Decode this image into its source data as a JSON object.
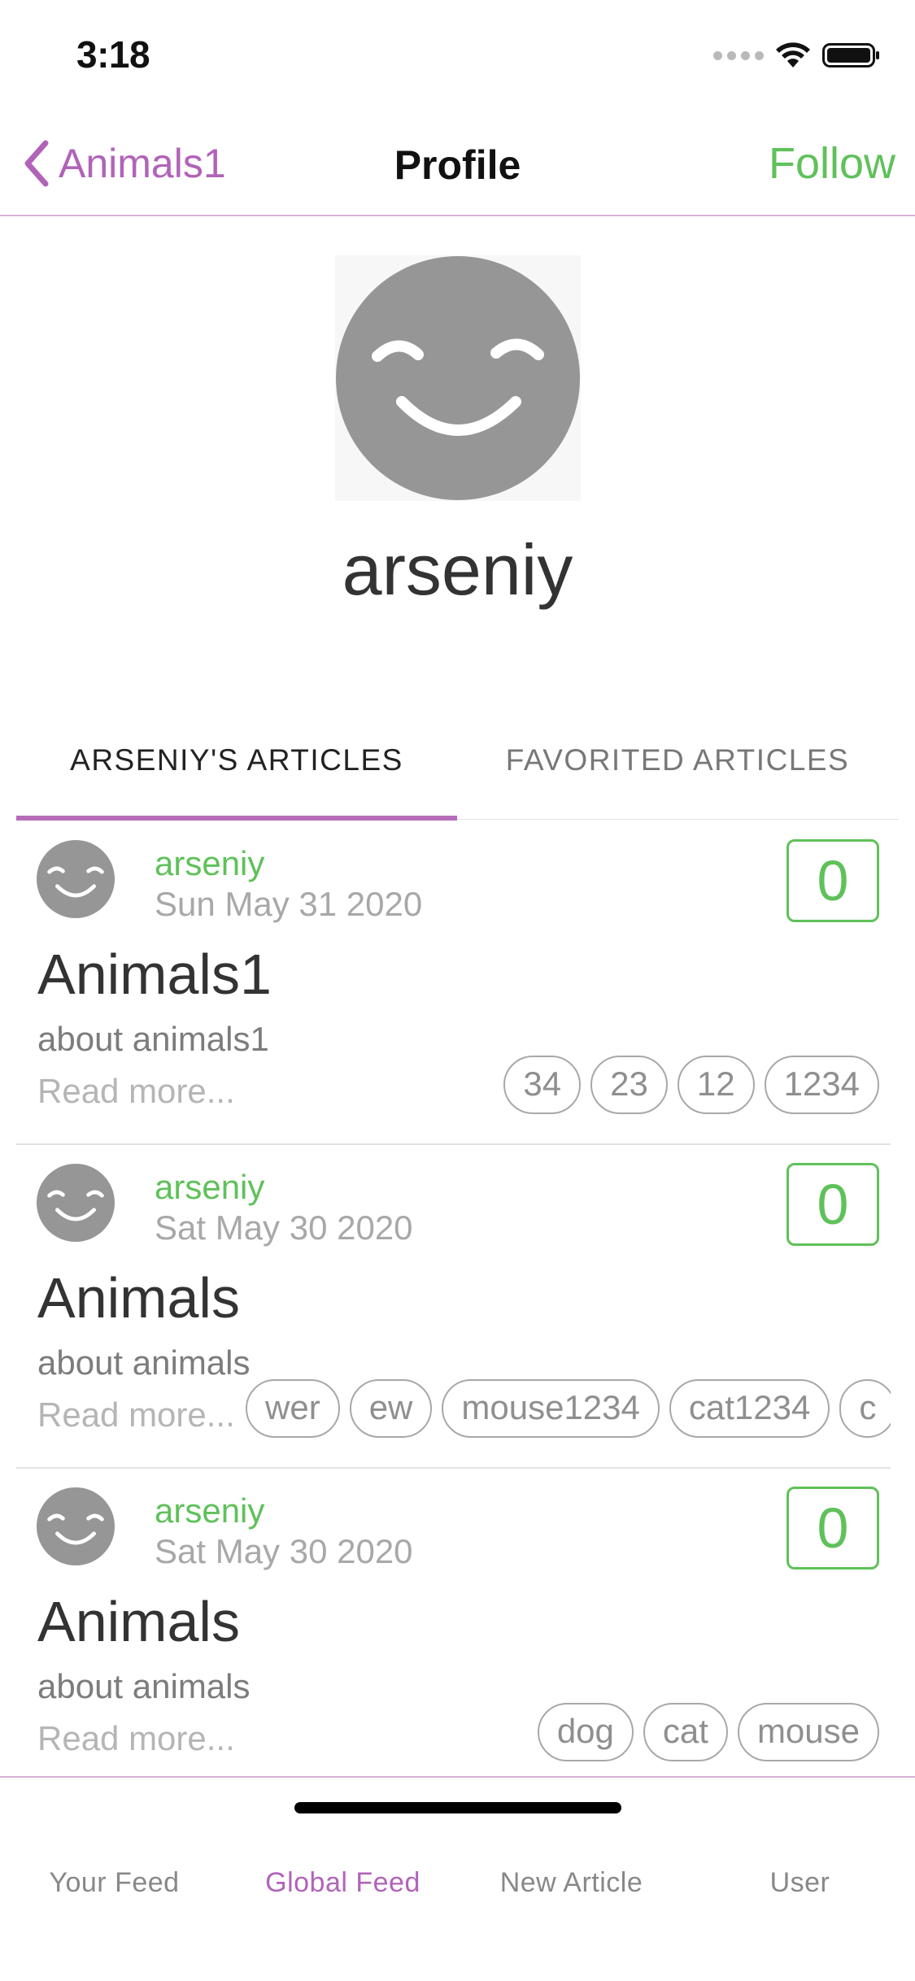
{
  "status_bar": {
    "time": "3:18"
  },
  "nav": {
    "back_label": "Animals1",
    "title": "Profile",
    "follow_label": "Follow"
  },
  "profile": {
    "username": "arseniy",
    "avatar_icon": "smiley-face-icon"
  },
  "tabs": [
    {
      "label": "ARSENIY'S ARTICLES",
      "active": true
    },
    {
      "label": "FAVORITED ARTICLES",
      "active": false
    }
  ],
  "articles": [
    {
      "author": "arseniy",
      "date": "Sun May 31 2020",
      "favorites": "0",
      "title": "Animals1",
      "description": "about animals1",
      "read_more": "Read more...",
      "tags": [
        "34",
        "23",
        "12",
        "1234"
      ]
    },
    {
      "author": "arseniy",
      "date": "Sat May 30 2020",
      "favorites": "0",
      "title": "Animals",
      "description": "about animals",
      "read_more": "Read more...",
      "tags": [
        "wer",
        "ew",
        "mouse1234",
        "cat1234",
        "c"
      ]
    },
    {
      "author": "arseniy",
      "date": "Sat May 30 2020",
      "favorites": "0",
      "title": "Animals",
      "description": "about animals",
      "read_more": "Read more...",
      "tags": [
        "dog",
        "cat",
        "mouse"
      ]
    }
  ],
  "tabbar": {
    "items": [
      {
        "label": "Your Feed",
        "active": false
      },
      {
        "label": "Global Feed",
        "active": true
      },
      {
        "label": "New Article",
        "active": false
      },
      {
        "label": "User",
        "active": false
      }
    ]
  },
  "colors": {
    "accent": "#b163b8",
    "green": "#5fc15a",
    "avatar_gray": "#969696"
  }
}
